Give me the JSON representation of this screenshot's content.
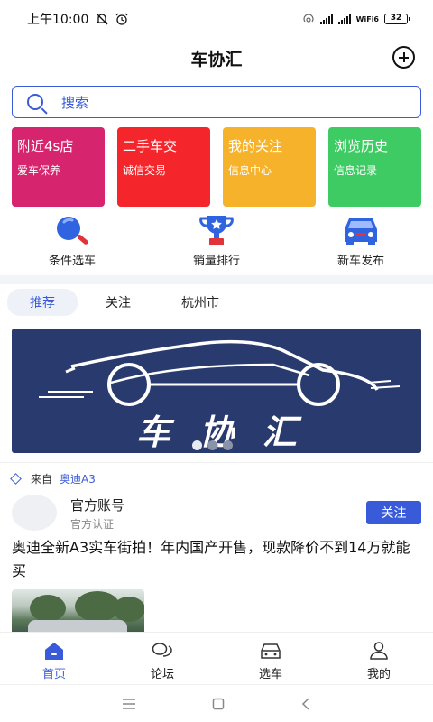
{
  "status": {
    "time": "上午10:00",
    "battery": "32",
    "net": "WiFi6"
  },
  "header": {
    "title": "车协汇"
  },
  "search": {
    "placeholder": "搜索"
  },
  "cards": [
    {
      "title": "附近4s店",
      "subtitle": "爱车保养",
      "color": "#d6246e"
    },
    {
      "title": "二手车交",
      "subtitle": "诚信交易",
      "color": "#f4262b"
    },
    {
      "title": "我的关注",
      "subtitle": "信息中心",
      "color": "#f6b22a"
    },
    {
      "title": "浏览历史",
      "subtitle": "信息记录",
      "color": "#3fcb63"
    }
  ],
  "quick": [
    {
      "label": "条件选车",
      "icon": "search-magnifier-icon"
    },
    {
      "label": "销量排行",
      "icon": "trophy-icon"
    },
    {
      "label": "新车发布",
      "icon": "car-icon"
    }
  ],
  "tabs": [
    {
      "label": "推荐",
      "active": true
    },
    {
      "label": "关注",
      "active": false
    },
    {
      "label": "杭州市",
      "active": false
    }
  ],
  "banner": {
    "text": "车协汇",
    "slide_count": 3,
    "active_slide": 1
  },
  "post": {
    "from_label": "来自",
    "from_tag": "奥迪A3",
    "account": "官方账号",
    "cert": "官方认证",
    "follow_label": "关注",
    "headline": "奥迪全新A3实车街拍！年内国产开售，现款降价不到14万就能买"
  },
  "bottom_nav": [
    {
      "label": "首页",
      "icon": "home-icon",
      "active": true
    },
    {
      "label": "论坛",
      "icon": "chat-bubbles-icon",
      "active": false
    },
    {
      "label": "选车",
      "icon": "car-outline-icon",
      "active": false
    },
    {
      "label": "我的",
      "icon": "person-icon",
      "active": false
    }
  ],
  "colors": {
    "accent": "#3a5bd9",
    "banner_bg": "#283a6e"
  }
}
